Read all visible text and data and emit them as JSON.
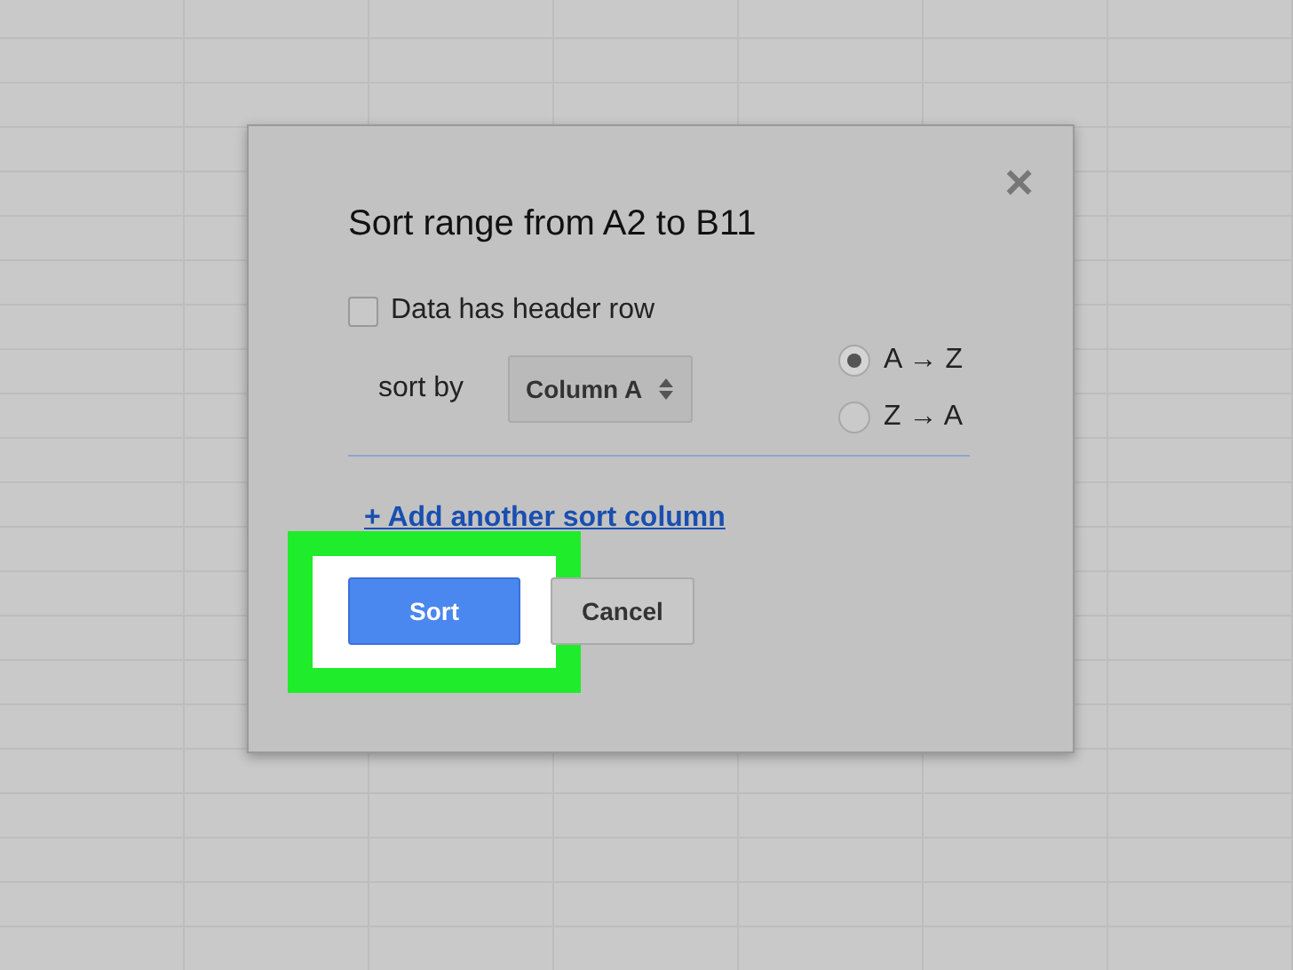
{
  "dialog": {
    "title": "Sort range from A2 to B11",
    "close": "×"
  },
  "header_row": {
    "label": "Data has header row",
    "checked": false
  },
  "sort_by": {
    "label": "sort by",
    "value": "Column A"
  },
  "order": [
    {
      "label": "A → Z",
      "selected": true
    },
    {
      "label": "Z → A",
      "selected": false
    }
  ],
  "add_link": "+ Add another sort column",
  "buttons": [
    {
      "label": "Sort",
      "kind": "primary",
      "highlighted": true
    },
    {
      "label": "Cancel",
      "kind": "secondary",
      "highlighted": false
    }
  ]
}
